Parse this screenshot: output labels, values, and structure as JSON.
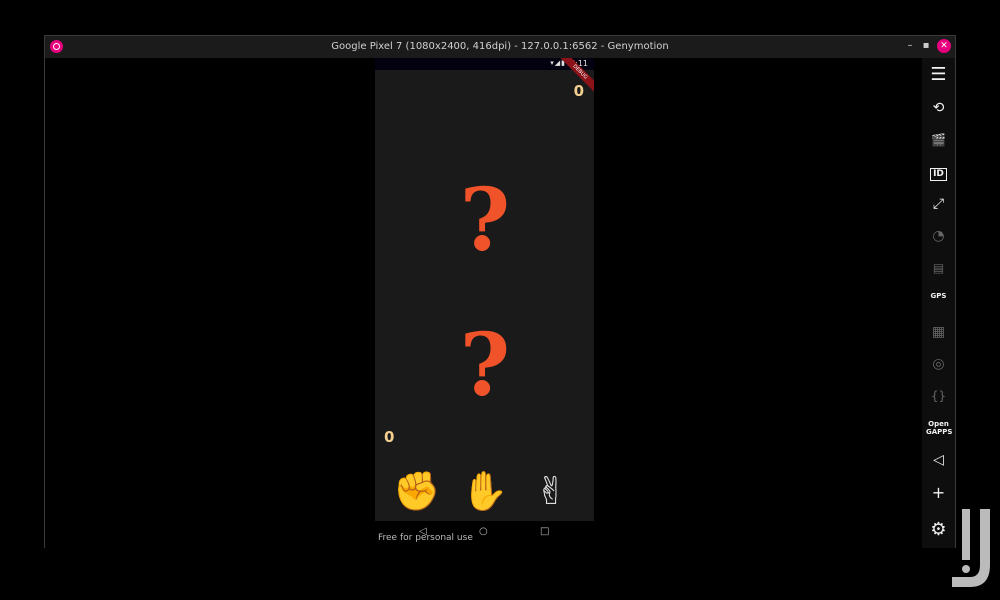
{
  "window": {
    "title": "Google Pixel 7 (1080x2400, 416dpi) - 127.0.0.1:6562 - Genymotion",
    "minimize_glyph": "–",
    "maximize_glyph": "▪",
    "close_glyph": "✕"
  },
  "status_bar": {
    "time": "7:11",
    "icons": "▾◢▮",
    "ribbon_text": "DEBUG"
  },
  "game": {
    "opponent_score": "0",
    "player_score": "0",
    "opponent_choice": "?",
    "player_choice": "?",
    "hands": [
      {
        "name": "rock",
        "glyph": "✊"
      },
      {
        "name": "paper",
        "glyph": "✋"
      },
      {
        "name": "scissors",
        "glyph": "✌"
      }
    ]
  },
  "nav": {
    "back": "◁",
    "home": "○",
    "recent": "□"
  },
  "watermark": "Free for personal use",
  "toolbar": [
    {
      "name": "menu-icon",
      "glyph": "☰"
    },
    {
      "name": "rotate-icon",
      "glyph": "⟲"
    },
    {
      "name": "clapperboard-icon",
      "glyph": "🎬"
    },
    {
      "name": "id-icon",
      "glyph": "ID"
    },
    {
      "name": "fullscreen-icon",
      "glyph": "⤢"
    },
    {
      "name": "rss-icon",
      "glyph": "◔"
    },
    {
      "name": "sd-card-icon",
      "glyph": "▤"
    },
    {
      "name": "gps-icon",
      "glyph": "GPS"
    },
    {
      "name": "film-icon",
      "glyph": "▦"
    },
    {
      "name": "fingerprint-icon",
      "glyph": "◎"
    },
    {
      "name": "braces-icon",
      "glyph": "{}"
    },
    {
      "name": "open-gapps-icon",
      "glyph": "Open GAPPS"
    },
    {
      "name": "back-triangle-icon",
      "glyph": "◁"
    },
    {
      "name": "add-icon",
      "glyph": "+"
    },
    {
      "name": "gear-icon",
      "glyph": "⚙"
    }
  ],
  "colors": {
    "accent_question": "#f0532a",
    "score": "#f2cf8f",
    "window_close": "#e6007e"
  }
}
